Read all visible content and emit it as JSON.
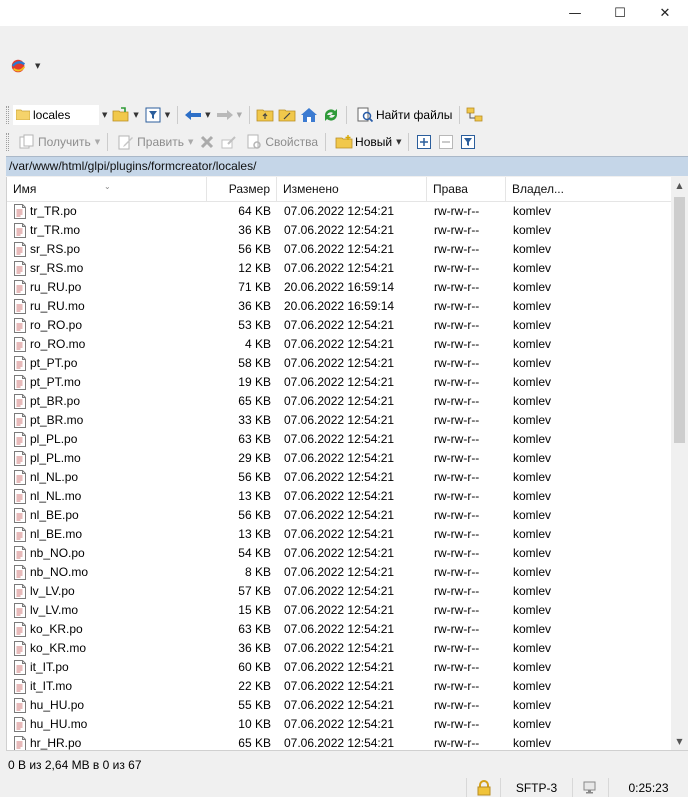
{
  "window": {
    "minimize_glyph": "—",
    "maximize_glyph": "☐",
    "close_glyph": "✕"
  },
  "toolbar": {
    "location_combo": "locales",
    "find_files_label": "Найти файлы",
    "download_label": "Получить",
    "edit_label": "Править",
    "properties_label": "Свойства",
    "new_label": "Новый"
  },
  "path": "/var/www/html/glpi/plugins/formcreator/locales/",
  "columns": {
    "name": "Имя",
    "size": "Размер",
    "modified": "Изменено",
    "rights": "Права",
    "owner": "Владел..."
  },
  "files": [
    {
      "name": "tr_TR.po",
      "size": "64 KB",
      "modified": "07.06.2022 12:54:21",
      "rights": "rw-rw-r--",
      "owner": "komlev"
    },
    {
      "name": "tr_TR.mo",
      "size": "36 KB",
      "modified": "07.06.2022 12:54:21",
      "rights": "rw-rw-r--",
      "owner": "komlev"
    },
    {
      "name": "sr_RS.po",
      "size": "56 KB",
      "modified": "07.06.2022 12:54:21",
      "rights": "rw-rw-r--",
      "owner": "komlev"
    },
    {
      "name": "sr_RS.mo",
      "size": "12 KB",
      "modified": "07.06.2022 12:54:21",
      "rights": "rw-rw-r--",
      "owner": "komlev"
    },
    {
      "name": "ru_RU.po",
      "size": "71 KB",
      "modified": "20.06.2022 16:59:14",
      "rights": "rw-rw-r--",
      "owner": "komlev"
    },
    {
      "name": "ru_RU.mo",
      "size": "36 KB",
      "modified": "20.06.2022 16:59:14",
      "rights": "rw-rw-r--",
      "owner": "komlev"
    },
    {
      "name": "ro_RO.po",
      "size": "53 KB",
      "modified": "07.06.2022 12:54:21",
      "rights": "rw-rw-r--",
      "owner": "komlev"
    },
    {
      "name": "ro_RO.mo",
      "size": "4 KB",
      "modified": "07.06.2022 12:54:21",
      "rights": "rw-rw-r--",
      "owner": "komlev"
    },
    {
      "name": "pt_PT.po",
      "size": "58 KB",
      "modified": "07.06.2022 12:54:21",
      "rights": "rw-rw-r--",
      "owner": "komlev"
    },
    {
      "name": "pt_PT.mo",
      "size": "19 KB",
      "modified": "07.06.2022 12:54:21",
      "rights": "rw-rw-r--",
      "owner": "komlev"
    },
    {
      "name": "pt_BR.po",
      "size": "65 KB",
      "modified": "07.06.2022 12:54:21",
      "rights": "rw-rw-r--",
      "owner": "komlev"
    },
    {
      "name": "pt_BR.mo",
      "size": "33 KB",
      "modified": "07.06.2022 12:54:21",
      "rights": "rw-rw-r--",
      "owner": "komlev"
    },
    {
      "name": "pl_PL.po",
      "size": "63 KB",
      "modified": "07.06.2022 12:54:21",
      "rights": "rw-rw-r--",
      "owner": "komlev"
    },
    {
      "name": "pl_PL.mo",
      "size": "29 KB",
      "modified": "07.06.2022 12:54:21",
      "rights": "rw-rw-r--",
      "owner": "komlev"
    },
    {
      "name": "nl_NL.po",
      "size": "56 KB",
      "modified": "07.06.2022 12:54:21",
      "rights": "rw-rw-r--",
      "owner": "komlev"
    },
    {
      "name": "nl_NL.mo",
      "size": "13 KB",
      "modified": "07.06.2022 12:54:21",
      "rights": "rw-rw-r--",
      "owner": "komlev"
    },
    {
      "name": "nl_BE.po",
      "size": "56 KB",
      "modified": "07.06.2022 12:54:21",
      "rights": "rw-rw-r--",
      "owner": "komlev"
    },
    {
      "name": "nl_BE.mo",
      "size": "13 KB",
      "modified": "07.06.2022 12:54:21",
      "rights": "rw-rw-r--",
      "owner": "komlev"
    },
    {
      "name": "nb_NO.po",
      "size": "54 KB",
      "modified": "07.06.2022 12:54:21",
      "rights": "rw-rw-r--",
      "owner": "komlev"
    },
    {
      "name": "nb_NO.mo",
      "size": "8 KB",
      "modified": "07.06.2022 12:54:21",
      "rights": "rw-rw-r--",
      "owner": "komlev"
    },
    {
      "name": "lv_LV.po",
      "size": "57 KB",
      "modified": "07.06.2022 12:54:21",
      "rights": "rw-rw-r--",
      "owner": "komlev"
    },
    {
      "name": "lv_LV.mo",
      "size": "15 KB",
      "modified": "07.06.2022 12:54:21",
      "rights": "rw-rw-r--",
      "owner": "komlev"
    },
    {
      "name": "ko_KR.po",
      "size": "63 KB",
      "modified": "07.06.2022 12:54:21",
      "rights": "rw-rw-r--",
      "owner": "komlev"
    },
    {
      "name": "ko_KR.mo",
      "size": "36 KB",
      "modified": "07.06.2022 12:54:21",
      "rights": "rw-rw-r--",
      "owner": "komlev"
    },
    {
      "name": "it_IT.po",
      "size": "60 KB",
      "modified": "07.06.2022 12:54:21",
      "rights": "rw-rw-r--",
      "owner": "komlev"
    },
    {
      "name": "it_IT.mo",
      "size": "22 KB",
      "modified": "07.06.2022 12:54:21",
      "rights": "rw-rw-r--",
      "owner": "komlev"
    },
    {
      "name": "hu_HU.po",
      "size": "55 KB",
      "modified": "07.06.2022 12:54:21",
      "rights": "rw-rw-r--",
      "owner": "komlev"
    },
    {
      "name": "hu_HU.mo",
      "size": "10 KB",
      "modified": "07.06.2022 12:54:21",
      "rights": "rw-rw-r--",
      "owner": "komlev"
    },
    {
      "name": "hr_HR.po",
      "size": "65 KB",
      "modified": "07.06.2022 12:54:21",
      "rights": "rw-rw-r--",
      "owner": "komlev"
    }
  ],
  "status": {
    "summary": "0 B из 2,64 MB в 0 из 67",
    "protocol": "SFTP-3",
    "elapsed": "0:25:23"
  },
  "icons": {
    "app": "session-icon",
    "folder": "folder-icon",
    "file": "file-icon",
    "lock": "lock-icon",
    "network": "network-icon"
  }
}
